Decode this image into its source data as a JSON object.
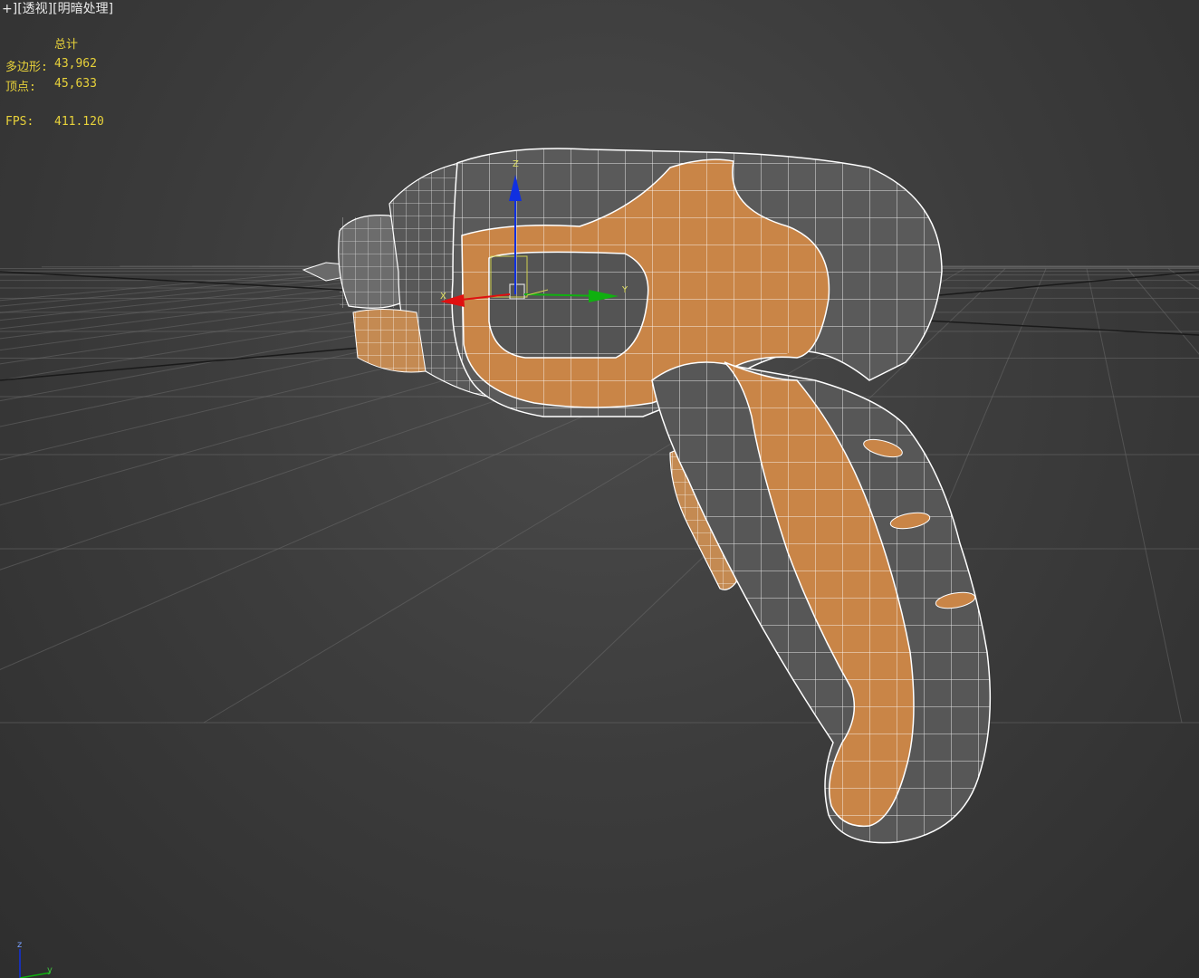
{
  "viewport": {
    "plus_menu": "+",
    "view_name": "透视",
    "shading": "明暗处理"
  },
  "stats": {
    "header": "总计",
    "polygons_label": "多边形:",
    "polygons_value": "43,962",
    "vertices_label": "顶点:",
    "vertices_value": "45,633",
    "fps_label": "FPS:",
    "fps_value": "411.120"
  },
  "gizmo": {
    "x_label": "X",
    "y_label": "Y",
    "z_label": "Z"
  },
  "view_cube": {
    "z_label": "z",
    "y_label": "y"
  },
  "colors": {
    "background": "#3d3d3d",
    "stats_text": "#e8d23a",
    "model_orange": "#c98547",
    "model_gray": "#5e5e5e",
    "wire": "#ffffff",
    "axis_x": "#e01010",
    "axis_y": "#10b010",
    "axis_z": "#1030e0"
  }
}
